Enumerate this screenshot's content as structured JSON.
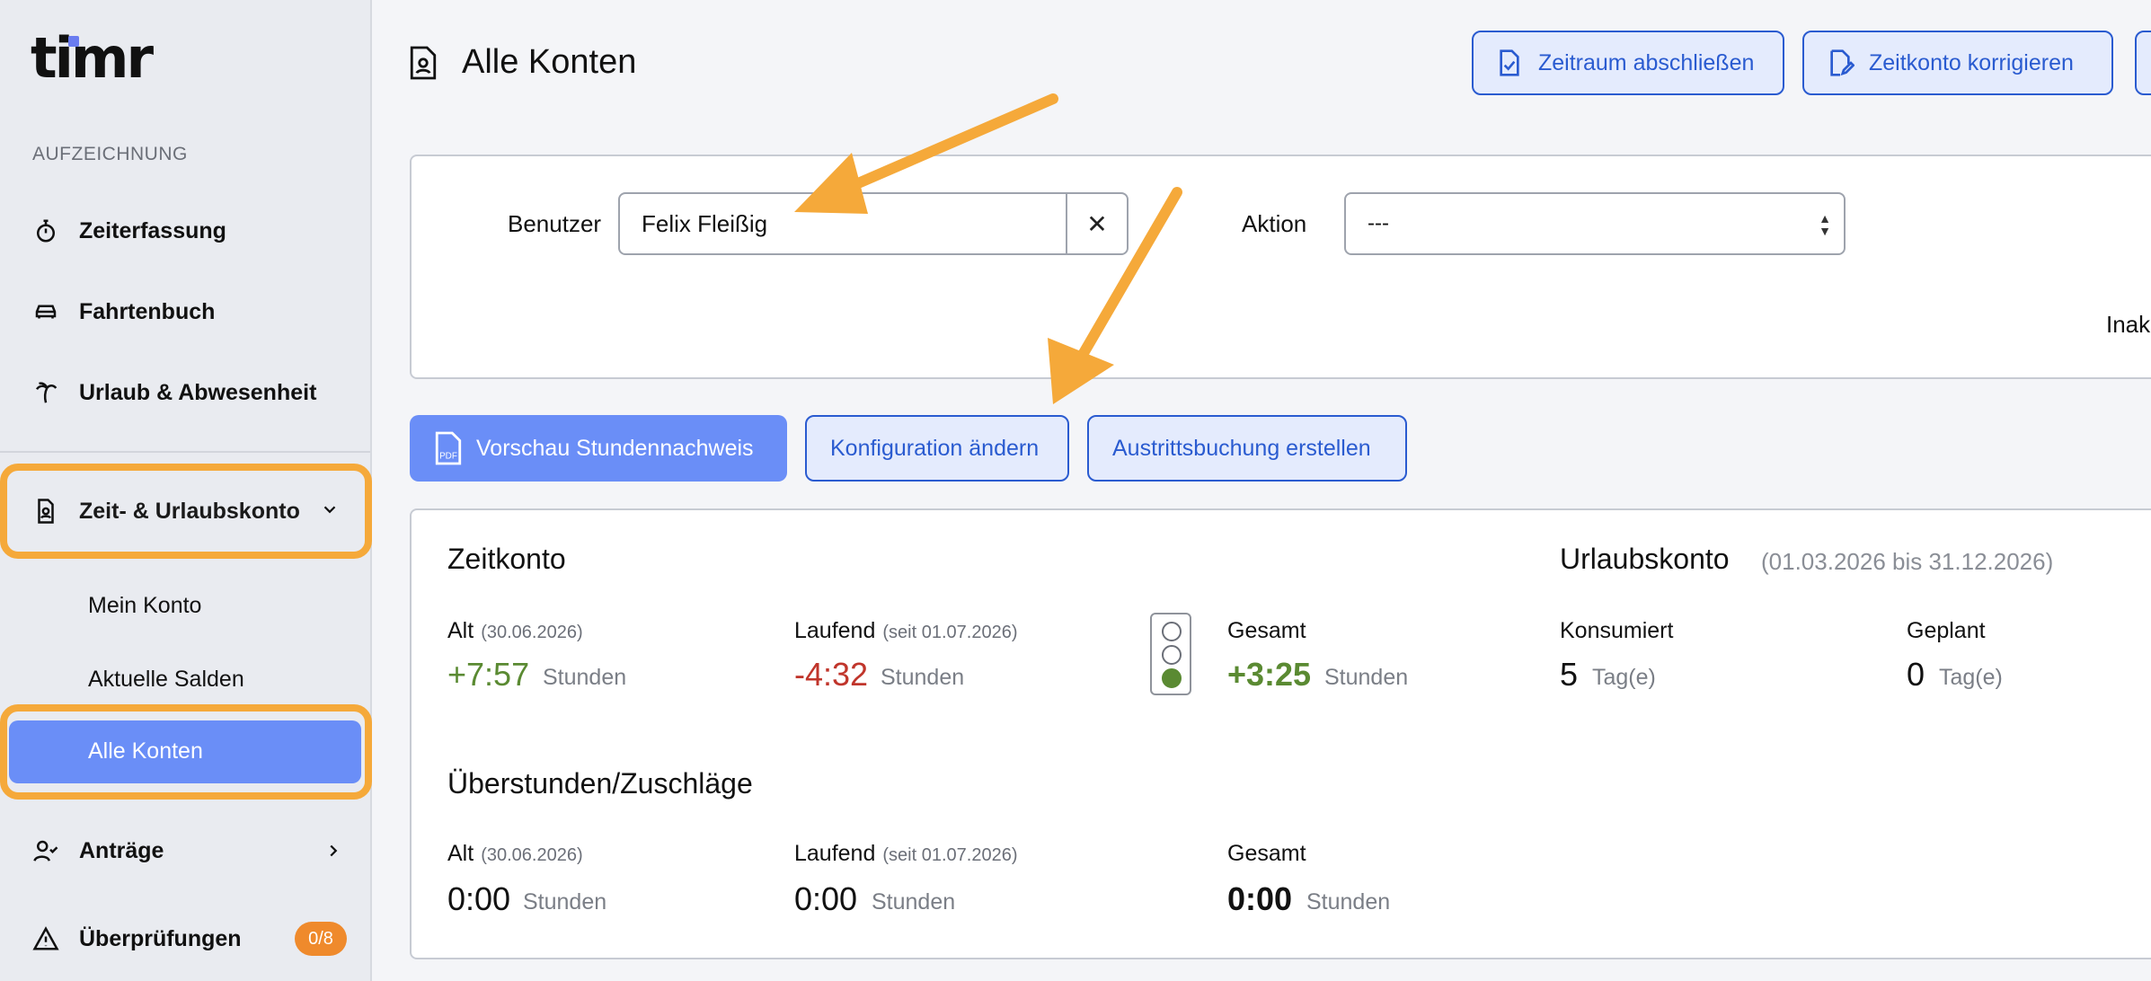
{
  "sidebar": {
    "logo": "timr",
    "section_label": "AUFZEICHNUNG",
    "items": [
      {
        "label": "Zeiterfassung"
      },
      {
        "label": "Fahrtenbuch"
      },
      {
        "label": "Urlaub & Abwesenheit"
      }
    ],
    "konto": {
      "label": "Zeit- & Urlaubskonto",
      "sub_items": [
        "Mein Konto",
        "Aktuelle Salden",
        "Alle Konten"
      ]
    },
    "antraege": "Anträge",
    "pruefungen": {
      "label": "Überprüfungen",
      "badge": "0/8"
    }
  },
  "header": {
    "title": "Alle Konten",
    "buttons": {
      "zeitraum": "Zeitraum abschließen",
      "korrigieren": "Zeitkonto korrigieren"
    }
  },
  "filter": {
    "user_label": "Benutzer",
    "user_value": "Felix Fleißig",
    "clear": "✕",
    "action_label": "Aktion",
    "action_value": "---",
    "inactive_label": "Inak"
  },
  "actions": {
    "preview": "Vorschau Stundennachweis",
    "config": "Konfiguration ändern",
    "exit": "Austrittsbuchung erstellen"
  },
  "zeitkonto": {
    "title": "Zeitkonto",
    "alt": {
      "label": "Alt",
      "note": "(30.06.2026)",
      "value": "+7:57",
      "unit": "Stunden"
    },
    "laufend": {
      "label": "Laufend",
      "note": "(seit 01.07.2026)",
      "value": "-4:32",
      "unit": "Stunden"
    },
    "gesamt": {
      "label": "Gesamt",
      "value": "+3:25",
      "unit": "Stunden"
    }
  },
  "urlaubskonto": {
    "title": "Urlaubskonto",
    "range": "(01.03.2026 bis 31.12.2026)",
    "konsumiert": {
      "label": "Konsumiert",
      "value": "5",
      "unit": "Tag(e)"
    },
    "geplant": {
      "label": "Geplant",
      "value": "0",
      "unit": "Tag(e)"
    }
  },
  "ueberstunden": {
    "title": "Überstunden/Zuschläge",
    "alt": {
      "label": "Alt",
      "note": "(30.06.2026)",
      "value": "0:00",
      "unit": "Stunden"
    },
    "laufend": {
      "label": "Laufend",
      "note": "(seit 01.07.2026)",
      "value": "0:00",
      "unit": "Stunden"
    },
    "gesamt": {
      "label": "Gesamt",
      "value": "0:00",
      "unit": "Stunden"
    }
  },
  "colors": {
    "accent": "#6a8ef7",
    "highlight": "#f5a93a",
    "positive": "#5a8a32",
    "negative": "#c0352b"
  }
}
